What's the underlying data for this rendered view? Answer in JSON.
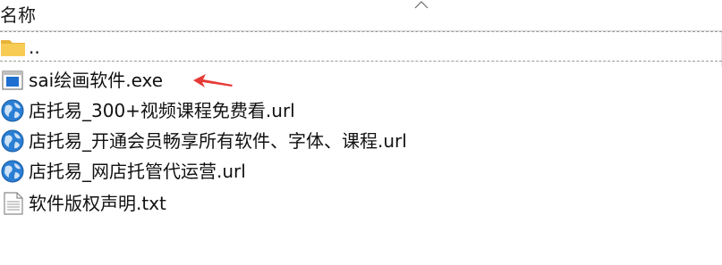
{
  "header": {
    "name_column": "名称",
    "sort_icon": "chevron-up-icon"
  },
  "files": [
    {
      "name": "..",
      "icon": "folder-icon"
    },
    {
      "name": "sai绘画软件.exe",
      "icon": "exe-app-icon"
    },
    {
      "name": "店托易_300+视频课程免费看.url",
      "icon": "internet-shortcut-globe-icon"
    },
    {
      "name": "店托易_开通会员畅享所有软件、字体、课程.url",
      "icon": "internet-shortcut-globe-icon"
    },
    {
      "name": "店托易_网店托管代运营.url",
      "icon": "internet-shortcut-globe-icon"
    },
    {
      "name": "软件版权声明.txt",
      "icon": "text-document-icon"
    }
  ],
  "annotation": {
    "icon": "red-arrow-icon",
    "color": "#e53935"
  }
}
